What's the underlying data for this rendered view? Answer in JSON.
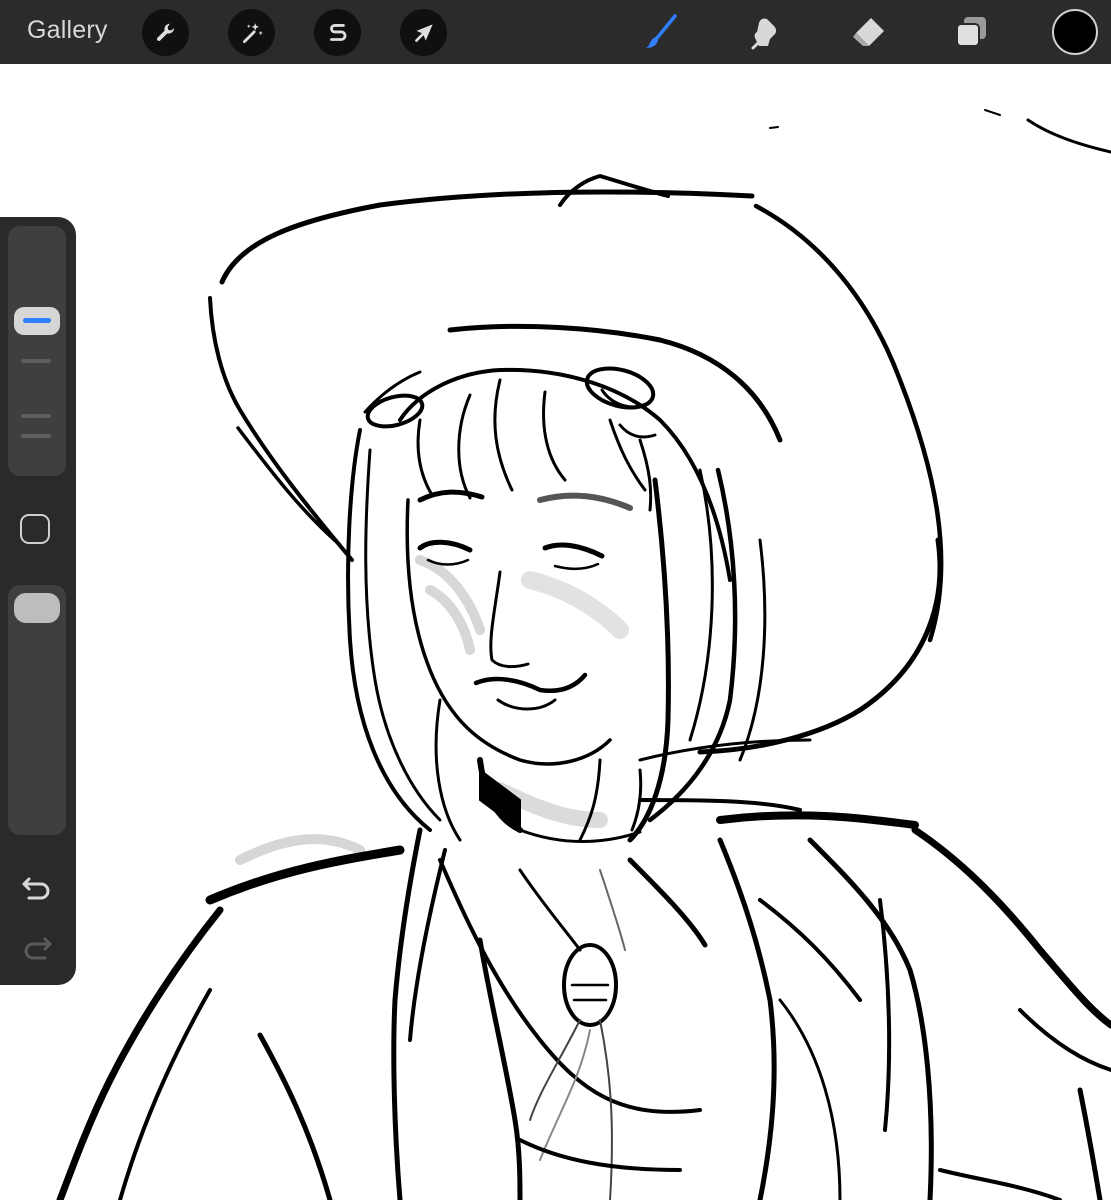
{
  "topbar": {
    "gallery_label": "Gallery",
    "left_tools": [
      {
        "name": "actions",
        "icon": "wrench-icon"
      },
      {
        "name": "adjustments",
        "icon": "magic-wand-icon"
      },
      {
        "name": "selection",
        "icon": "selection-s-icon"
      },
      {
        "name": "transform",
        "icon": "arrow-cursor-icon"
      }
    ],
    "right_tools": [
      {
        "name": "brush",
        "icon": "brush-icon",
        "active": true
      },
      {
        "name": "smudge",
        "icon": "smudge-finger-icon",
        "active": false
      },
      {
        "name": "eraser",
        "icon": "eraser-icon",
        "active": false
      },
      {
        "name": "layers",
        "icon": "layers-icon",
        "active": false
      }
    ],
    "current_color": "#000000"
  },
  "sidebar": {
    "brush_size_level": 0.65,
    "opacity_level": 1.0,
    "icons": [
      "modify-square-icon",
      "undo-icon",
      "redo-icon"
    ]
  },
  "colors": {
    "bar_background": "#2b2b2b",
    "accent_blue": "#2f7fff",
    "canvas": "#ffffff",
    "ink": "#000000"
  }
}
